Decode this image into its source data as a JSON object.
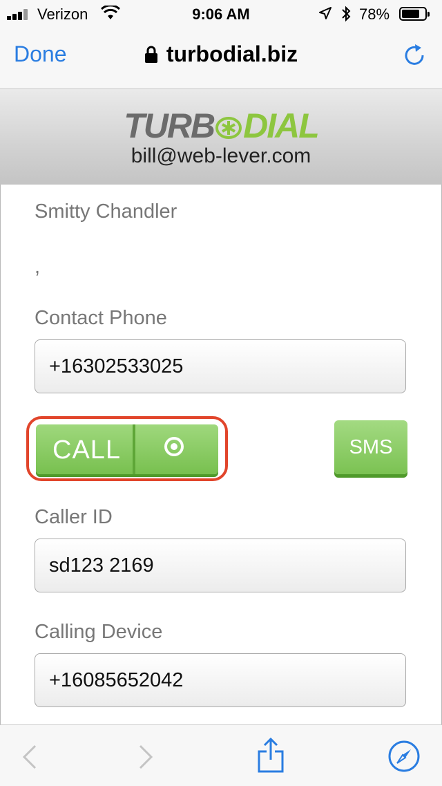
{
  "status_bar": {
    "carrier": "Verizon",
    "time": "9:06 AM",
    "battery_percent": "78%",
    "battery_level": 0.78
  },
  "nav": {
    "done_label": "Done",
    "url": "turbodial.biz"
  },
  "header": {
    "logo_left": "TURB",
    "logo_right": "DIAL",
    "email": "bill@web-lever.com"
  },
  "contact": {
    "name": "Smitty Chandler",
    "address": ",",
    "phone_label": "Contact Phone",
    "phone_value": "+16302533025",
    "call_label": "CALL",
    "sms_label": "SMS",
    "caller_id_label": "Caller ID",
    "caller_id_value": "sd123 2169",
    "calling_device_label": "Calling Device",
    "calling_device_value": "+16085652042"
  },
  "colors": {
    "accent_blue": "#2a7de1",
    "call_green": "#78c04f",
    "highlight_red": "#e1452b"
  },
  "icons": [
    "signal-icon",
    "wifi-icon",
    "location-icon",
    "bluetooth-icon",
    "battery-icon",
    "lock-icon",
    "reload-icon",
    "back-icon",
    "forward-icon",
    "share-icon",
    "compass-icon",
    "record-icon"
  ]
}
